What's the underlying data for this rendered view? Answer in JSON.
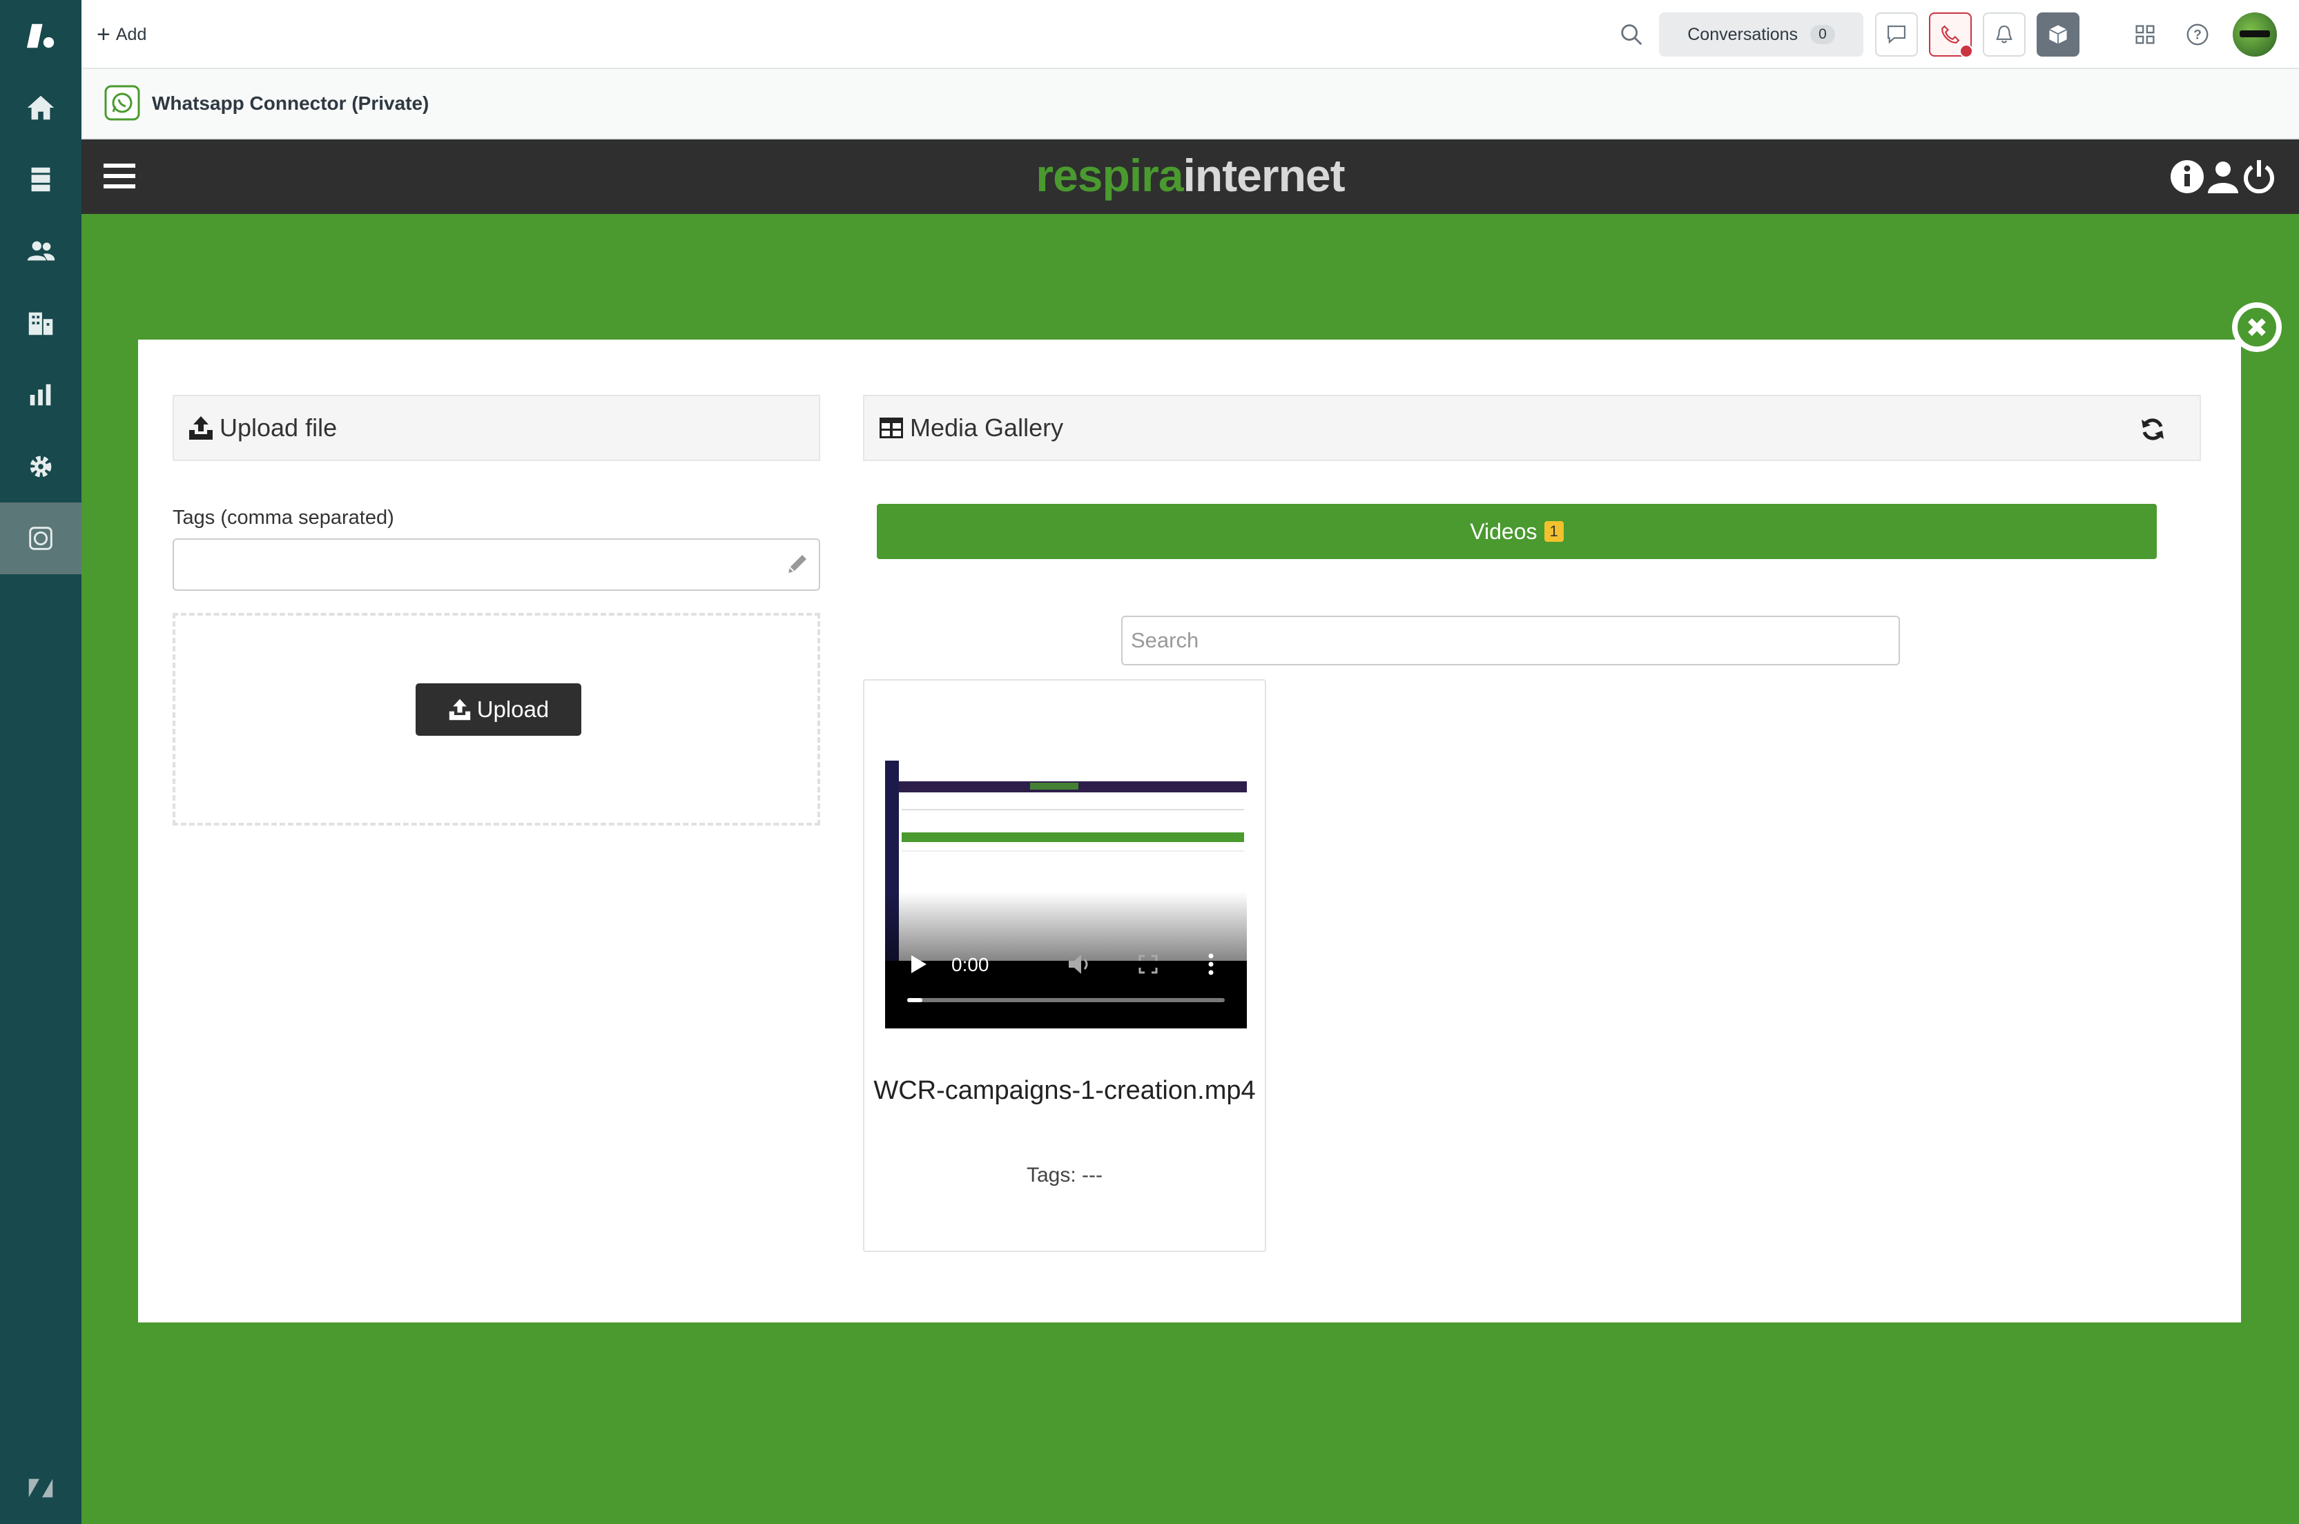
{
  "topbar": {
    "add_label": "Add",
    "conversations_label": "Conversations",
    "conversations_count": "0"
  },
  "app": {
    "title": "Whatsapp Connector (Private)"
  },
  "brand": {
    "logo_part1": "respira",
    "logo_part2": "internet",
    "accent_color": "#4a9a2f"
  },
  "upload": {
    "header": "Upload file",
    "tags_label": "Tags (comma separated)",
    "tags_value": "",
    "button_label": "Upload"
  },
  "gallery": {
    "header": "Media Gallery",
    "tab_label": "Videos",
    "tab_count": "1",
    "search_placeholder": "Search",
    "items": [
      {
        "filename": "WCR-campaigns-1-creation.mp4",
        "tags": "Tags: ---",
        "time": "0:00"
      }
    ]
  }
}
